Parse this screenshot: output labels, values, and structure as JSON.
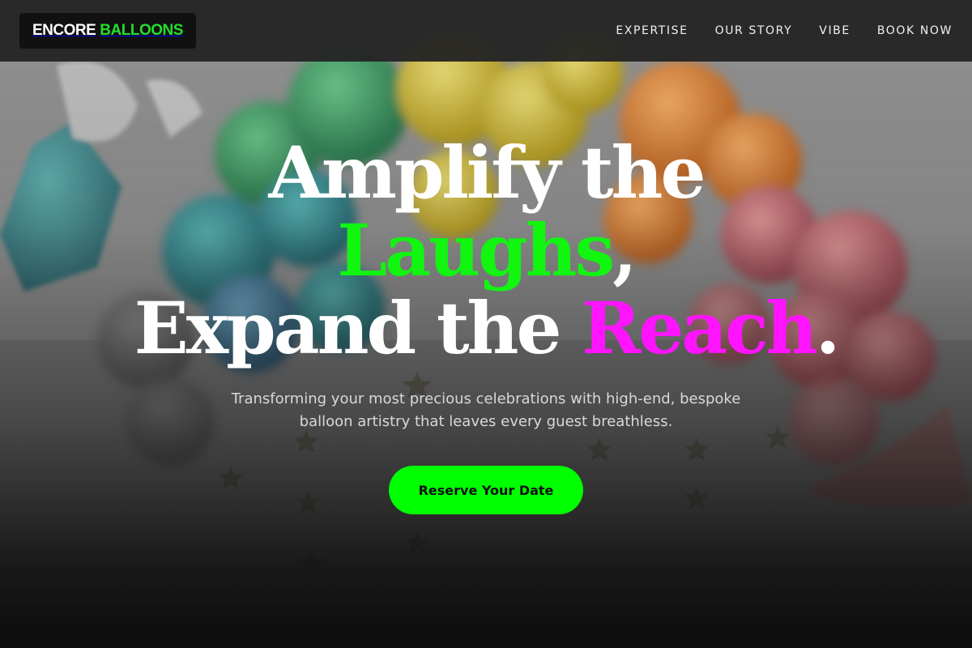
{
  "brand": {
    "name_part1": "ENCORE",
    "name_part2": "BALLOONS"
  },
  "nav": {
    "items": [
      {
        "label": "EXPERTISE"
      },
      {
        "label": "OUR STORY"
      },
      {
        "label": "VIBE"
      },
      {
        "label": "BOOK NOW"
      }
    ]
  },
  "hero": {
    "line1": "Amplify the",
    "line2_highlight": "Laughs",
    "line2_punct": ",",
    "line3_prefix": "Expand the ",
    "line3_highlight": "Reach",
    "line3_punct": ".",
    "subtitle": "Transforming your most precious celebrations with high-end, bespoke balloon artistry that leaves every guest breathless.",
    "cta_label": "Reserve Your Date"
  },
  "colors": {
    "accent_green": "#00ff00",
    "accent_magenta": "#ff14ff",
    "nav_bg": "#242424",
    "logo_green": "#22e02a"
  },
  "background": {
    "icon": "balloon-garland-photo"
  }
}
